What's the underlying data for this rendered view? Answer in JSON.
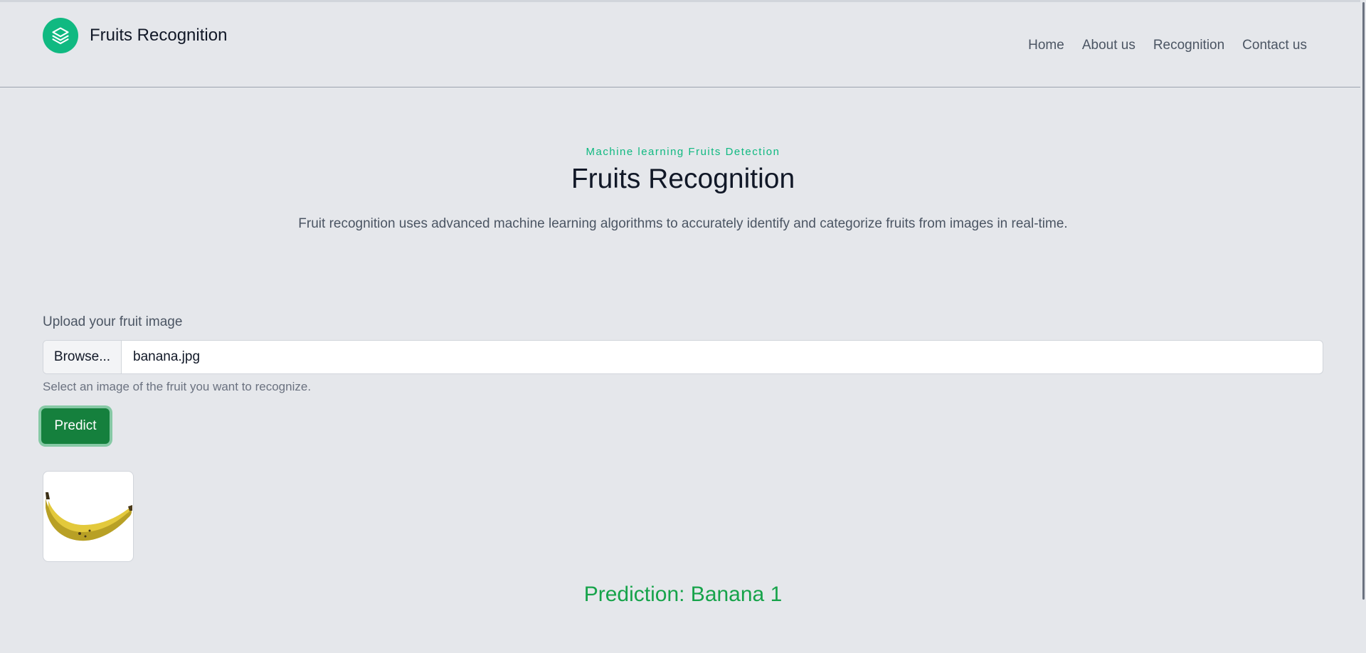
{
  "app": {
    "title": "Fruits Recognition",
    "accent": "#10b981",
    "button_color": "#15803d",
    "prediction_color": "#16a34a"
  },
  "nav": {
    "items": [
      {
        "label": "Home"
      },
      {
        "label": "About us"
      },
      {
        "label": "Recognition"
      },
      {
        "label": "Contact us"
      }
    ]
  },
  "hero": {
    "eyebrow": "Machine learning Fruits Detection",
    "title": "Fruits Recognition",
    "description": "Fruit recognition uses advanced machine learning algorithms to accurately identify and categorize fruits from images in real-time."
  },
  "upload": {
    "label": "Upload your fruit image",
    "browse_label": "Browse...",
    "file_name": "banana.jpg",
    "help": "Select an image of the fruit you want to recognize.",
    "predict_label": "Predict"
  },
  "preview": {
    "icon": "banana-image"
  },
  "result": {
    "text": "Prediction: Banana 1"
  }
}
